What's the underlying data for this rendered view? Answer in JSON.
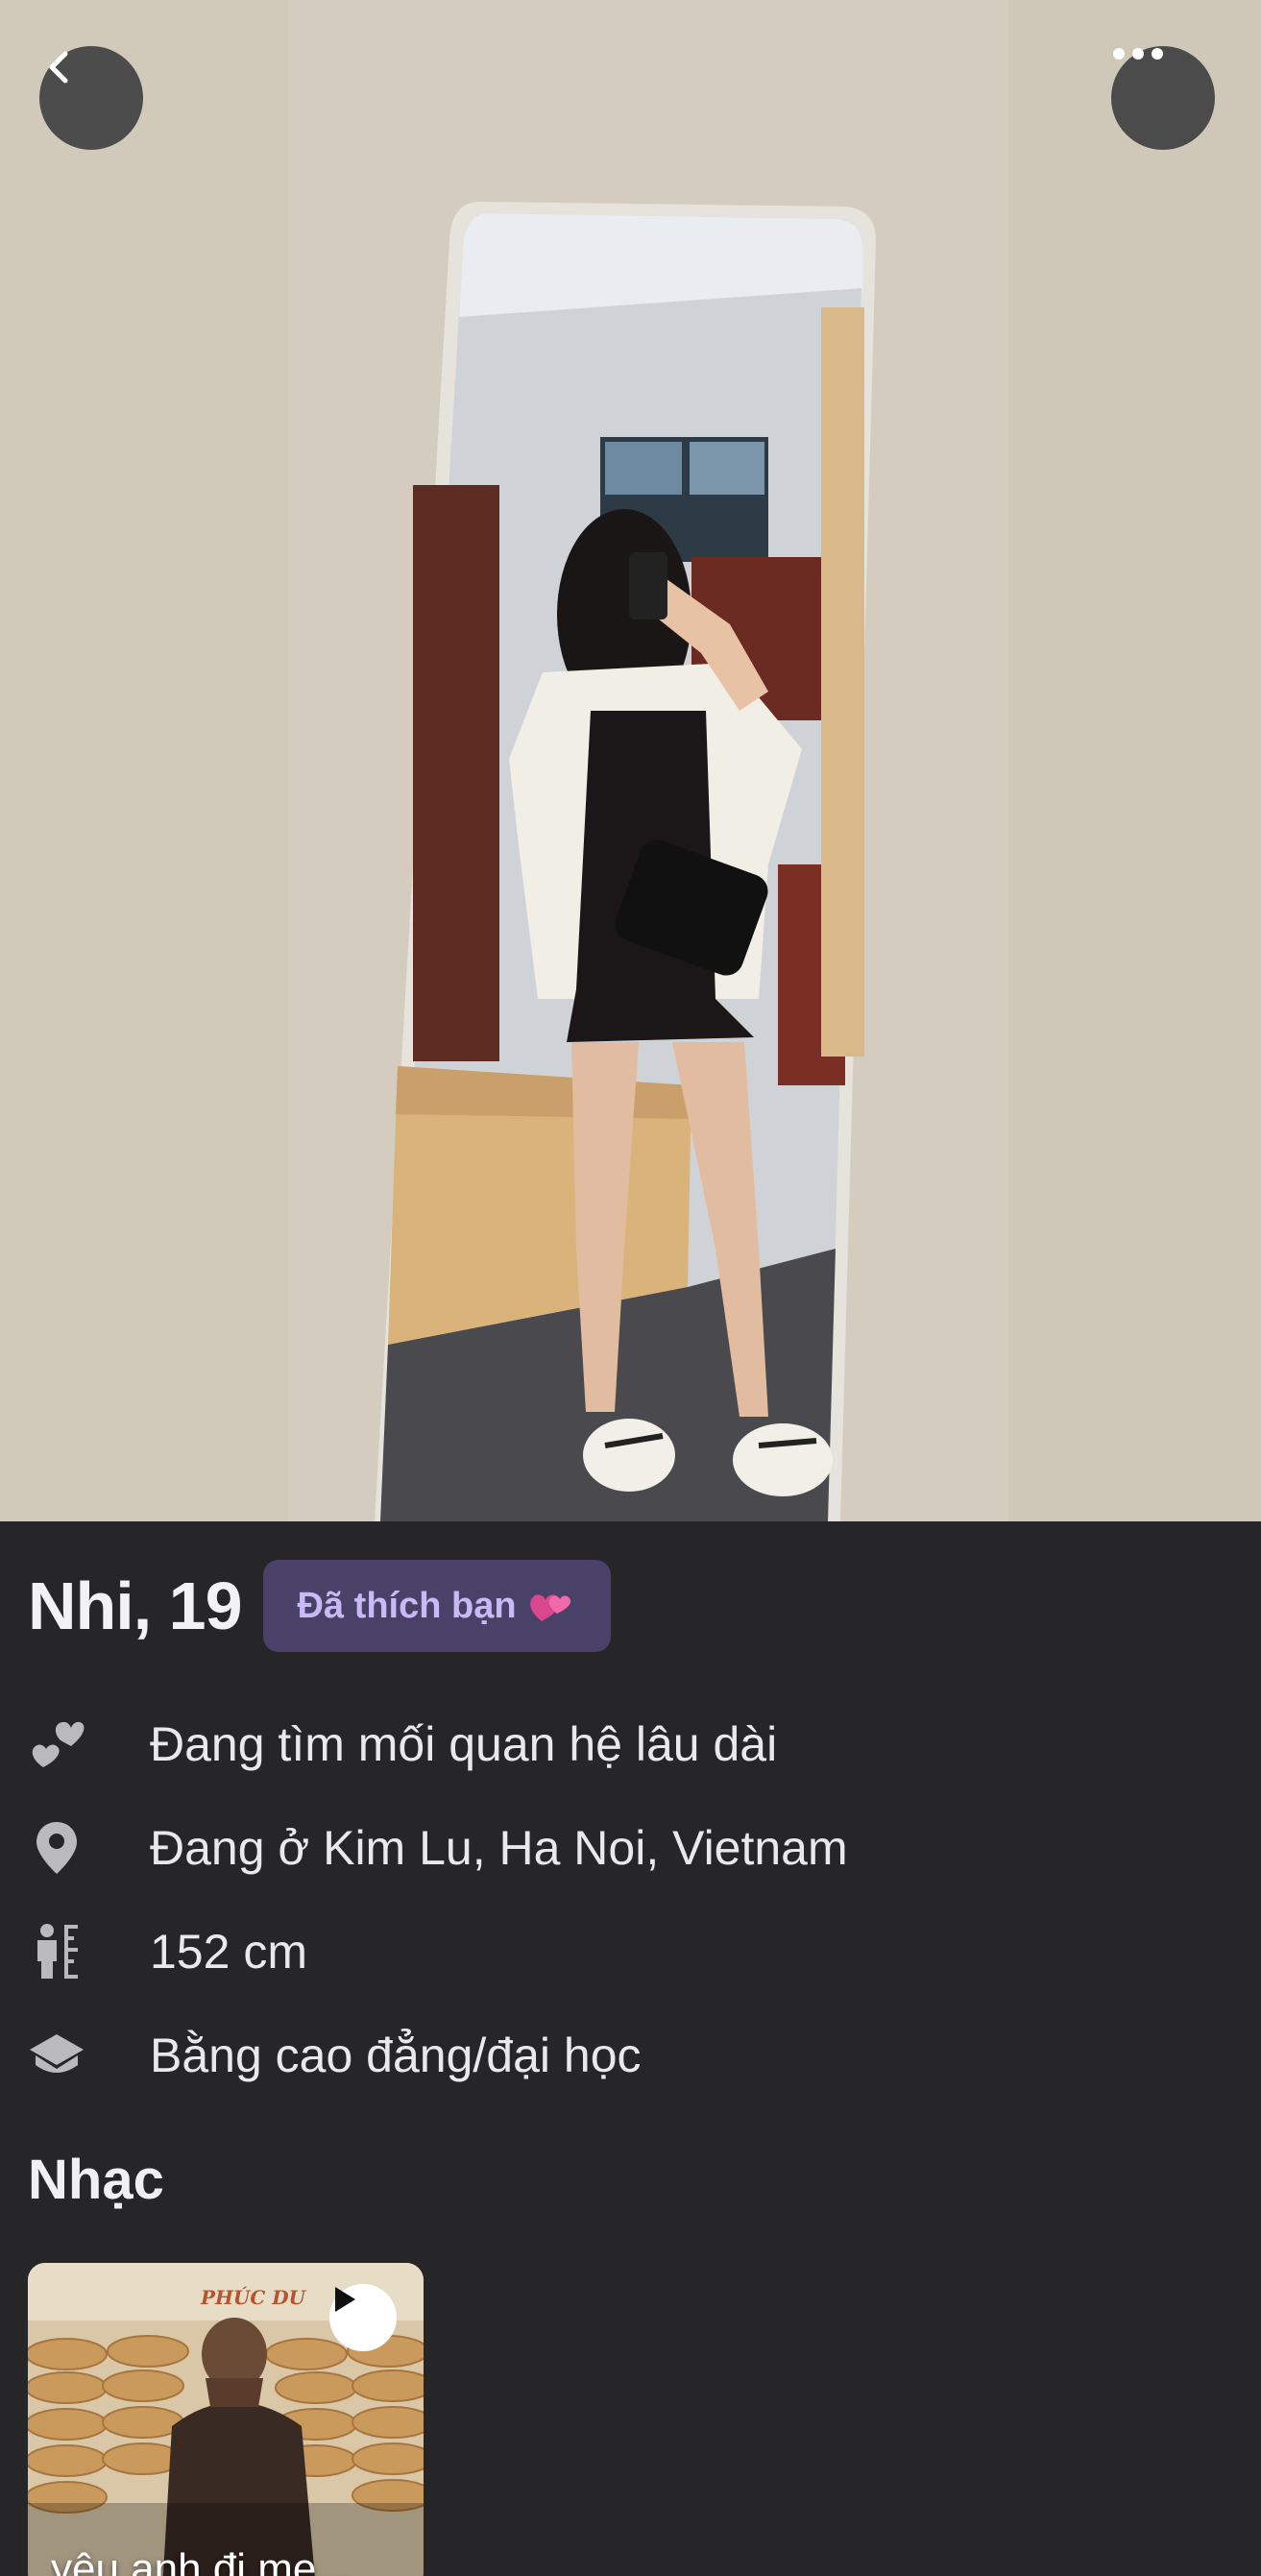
{
  "header": {
    "back_icon": "chevron-left-icon",
    "more_icon": "ellipsis-horizontal-icon"
  },
  "profile": {
    "name_age": "Nhi, 19",
    "liked_badge": "Đã thích bạn",
    "liked_badge_icon": "two-hearts-emoji",
    "details": [
      {
        "icon": "hearts-icon",
        "text": "Đang tìm mối quan hệ lâu dài"
      },
      {
        "icon": "location-pin-icon",
        "text": "Đang ở Kim Lu, Ha Noi, Vietnam"
      },
      {
        "icon": "height-icon",
        "text": "152 cm"
      },
      {
        "icon": "graduation-cap-icon",
        "text": "Bằng cao đẳng/đại học"
      }
    ]
  },
  "music": {
    "section_title": "Nhạc",
    "track": {
      "title": "yêu anh đi me...",
      "album_artist_text": "PHÚC DU",
      "play_icon": "play-icon"
    }
  },
  "colors": {
    "background": "#262629",
    "badge_bg": "#4a4168",
    "badge_text": "#c9b9f4",
    "text_primary": "#eeeef0",
    "icon_gray": "#b9b9be"
  }
}
